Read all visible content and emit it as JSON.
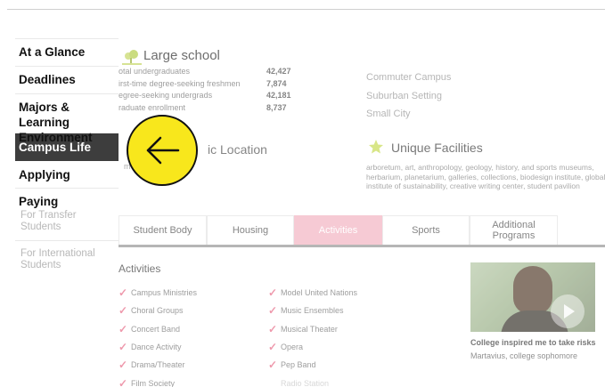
{
  "sidebar": {
    "items": [
      {
        "label": "At a Glance"
      },
      {
        "label": "Deadlines"
      },
      {
        "label": "Majors & Learning Environment"
      },
      {
        "label": "Campus Life"
      },
      {
        "label": "Applying"
      },
      {
        "label": "Paying"
      }
    ],
    "sub_items": [
      {
        "label": "For Transfer Students"
      },
      {
        "label": "For International Students"
      }
    ],
    "active_color": "#3d3d3d"
  },
  "school_size": {
    "title": "Large school",
    "stats": [
      {
        "label": "otal undergraduates",
        "value": "42,427"
      },
      {
        "label": "irst-time degree-seeking freshmen",
        "value": "7,874"
      },
      {
        "label": "egree-seeking undergrads",
        "value": "42,181"
      },
      {
        "label": "raduate enrollment",
        "value": "8,737"
      }
    ]
  },
  "campus_tags": [
    "Commuter Campus",
    "Suburban Setting",
    "Small City"
  ],
  "location": {
    "title_fragment": "ic Location",
    "text_fragment": "m"
  },
  "unique_facilities": {
    "title": "Unique Facilities",
    "text": "arboretum, art, anthropology, geology, history, and sports museums, herbarium, planetarium, galleries, collections, biodesign institute, global institute of sustainability, creative writing center, student pavilion"
  },
  "tabs": [
    {
      "label": "Student Body"
    },
    {
      "label": "Housing"
    },
    {
      "label": "Activities",
      "active": true
    },
    {
      "label": "Sports"
    },
    {
      "label": "Additional Programs"
    }
  ],
  "activities": {
    "title": "Activities",
    "col1": [
      "Campus Ministries",
      "Choral Groups",
      "Concert Band",
      "Dance Activity",
      "Drama/Theater",
      "Film Society"
    ],
    "col2": [
      "Model United Nations",
      "Music Ensembles",
      "Musical Theater",
      "Opera",
      "Pep Band",
      "Radio Station"
    ]
  },
  "video": {
    "caption": "College inspired me to take risks",
    "subcaption": "Martavius, college sophomore"
  },
  "colors": {
    "accent_pink": "#f3b6c4",
    "check_pink": "#e8728c",
    "back_button": "#f8e71c"
  },
  "icons": {
    "back": "arrow-left-icon",
    "tree": "tree-icon",
    "star": "star-icon",
    "play": "play-icon"
  }
}
